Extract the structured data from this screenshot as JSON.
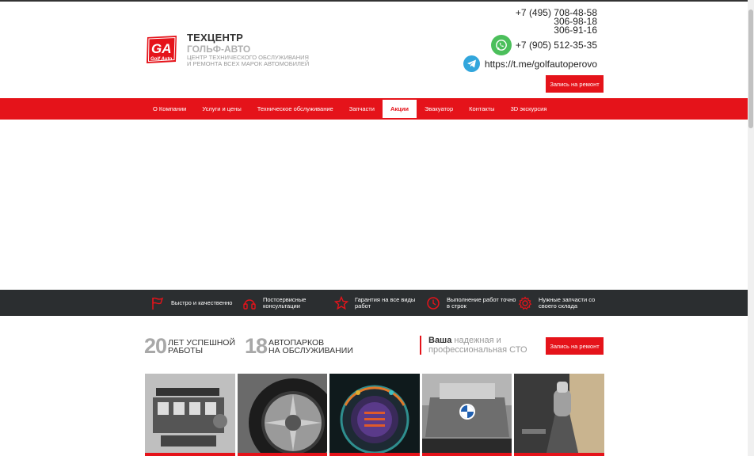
{
  "header": {
    "logo_text": "GA",
    "logo_sub": "Golf Auto",
    "title": "ТЕХЦЕНТР",
    "subtitle": "ГОЛЬФ-АВТО",
    "desc_line1": "ЦЕНТР ТЕХНИЧЕСКОГО ОБСЛУЖИВАНИЯ",
    "desc_line2": "И РЕМОНТА ВСЕХ МАРОК АВТОМОБИЛЕЙ",
    "phone1": "+7 (495) 708-48-58",
    "phone2": "306-98-18",
    "phone3": "306-91-16",
    "whatsapp_phone": "+7 (905) 512-35-35",
    "telegram_link": "https://t.me/golfautoperovo",
    "cta_label": "Запись на ремонт"
  },
  "nav": {
    "items": [
      {
        "label": "О Компании"
      },
      {
        "label": "Услуги и цены"
      },
      {
        "label": "Техническое обслуживание"
      },
      {
        "label": "Запчасти"
      },
      {
        "label": "Акции"
      },
      {
        "label": "Эвакуатор"
      },
      {
        "label": "Контакты"
      },
      {
        "label": "3D экскурсия"
      }
    ],
    "active_index": 4
  },
  "features": [
    {
      "icon": "flag-icon",
      "text": "Быстро и качественно"
    },
    {
      "icon": "headphones-icon",
      "text": "Постсервисные консультации"
    },
    {
      "icon": "star-icon",
      "text": "Гарантия на все виды работ"
    },
    {
      "icon": "clock-icon",
      "text": "Выполнение работ точно в строк"
    },
    {
      "icon": "gear-icon",
      "text": "Нужные запчасти со своего склада"
    }
  ],
  "stats": {
    "years_num": "20",
    "years_line1": "ЛЕТ УСПЕШНОЙ",
    "years_line2": "РАБОТЫ",
    "fleets_num": "18",
    "fleets_line1": "АВТОПАРКОВ",
    "fleets_line2": "НА ОБСЛУЖИВАНИИ",
    "sto_bold": "Ваша",
    "sto_rest1": " надежная и",
    "sto_line2": "профессиональная СТО",
    "cta_label": "Запись на ремонт"
  },
  "gallery": [
    {
      "name": "engine-block-image"
    },
    {
      "name": "tire-image"
    },
    {
      "name": "dashboard-gauge-image"
    },
    {
      "name": "bmw-engine-image"
    },
    {
      "name": "gear-shifter-image"
    }
  ],
  "colors": {
    "accent": "#e5131a",
    "dark_bar": "#2b2e30"
  }
}
